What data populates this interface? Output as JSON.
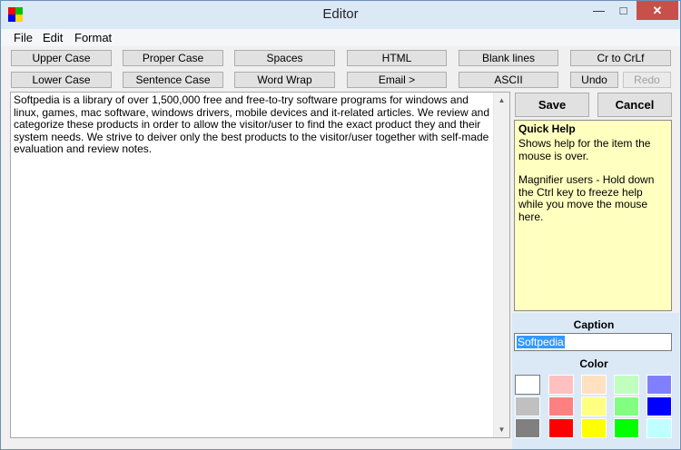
{
  "window": {
    "title": "Editor"
  },
  "app_icon_colors": [
    "#ff0000",
    "#00c000",
    "#0000ff",
    "#ffd700"
  ],
  "controls": {
    "minimize": "—",
    "maximize": "□",
    "close": "✕"
  },
  "menu": {
    "items": [
      "File",
      "Edit",
      "Format"
    ]
  },
  "toolbar": {
    "row1": [
      "Upper Case",
      "Proper Case",
      "Spaces",
      "HTML",
      "Blank lines",
      "Cr to CrLf"
    ],
    "row2": [
      "Lower Case",
      "Sentence Case",
      "Word Wrap",
      "Email >",
      "ASCII"
    ],
    "undo": "Undo",
    "redo": "Redo"
  },
  "editor": {
    "text": "Softpedia is a library of over 1,500,000 free and free-to-try software programs for windows and linux, games, mac software, windows drivers, mobile devices and it-related articles. We review and categorize these products in order to allow the visitor/user to find the exact product they and their system needs. We strive to deiver only the best products to the visitor/user together with self-made evaluation and review notes."
  },
  "actions": {
    "save": "Save",
    "cancel": "Cancel"
  },
  "quick_help": {
    "title": "Quick Help",
    "line1": "Shows help for the item the mouse is over.",
    "line2": "Magnifier users - Hold down the Ctrl key to freeze help while you move the mouse here."
  },
  "caption": {
    "label": "Caption",
    "value": "Softpedia"
  },
  "color": {
    "label": "Color",
    "swatches": [
      [
        "#ffffff",
        "#ffc0c0",
        "#ffe0c0",
        "#c0ffc0",
        "#8080ff"
      ],
      [
        "#c0c0c0",
        "#ff8080",
        "#ffff80",
        "#80ff80",
        "#0000ff"
      ],
      [
        "#808080",
        "#ff0000",
        "#ffff00",
        "#00ff00",
        "#c0ffff"
      ]
    ]
  }
}
